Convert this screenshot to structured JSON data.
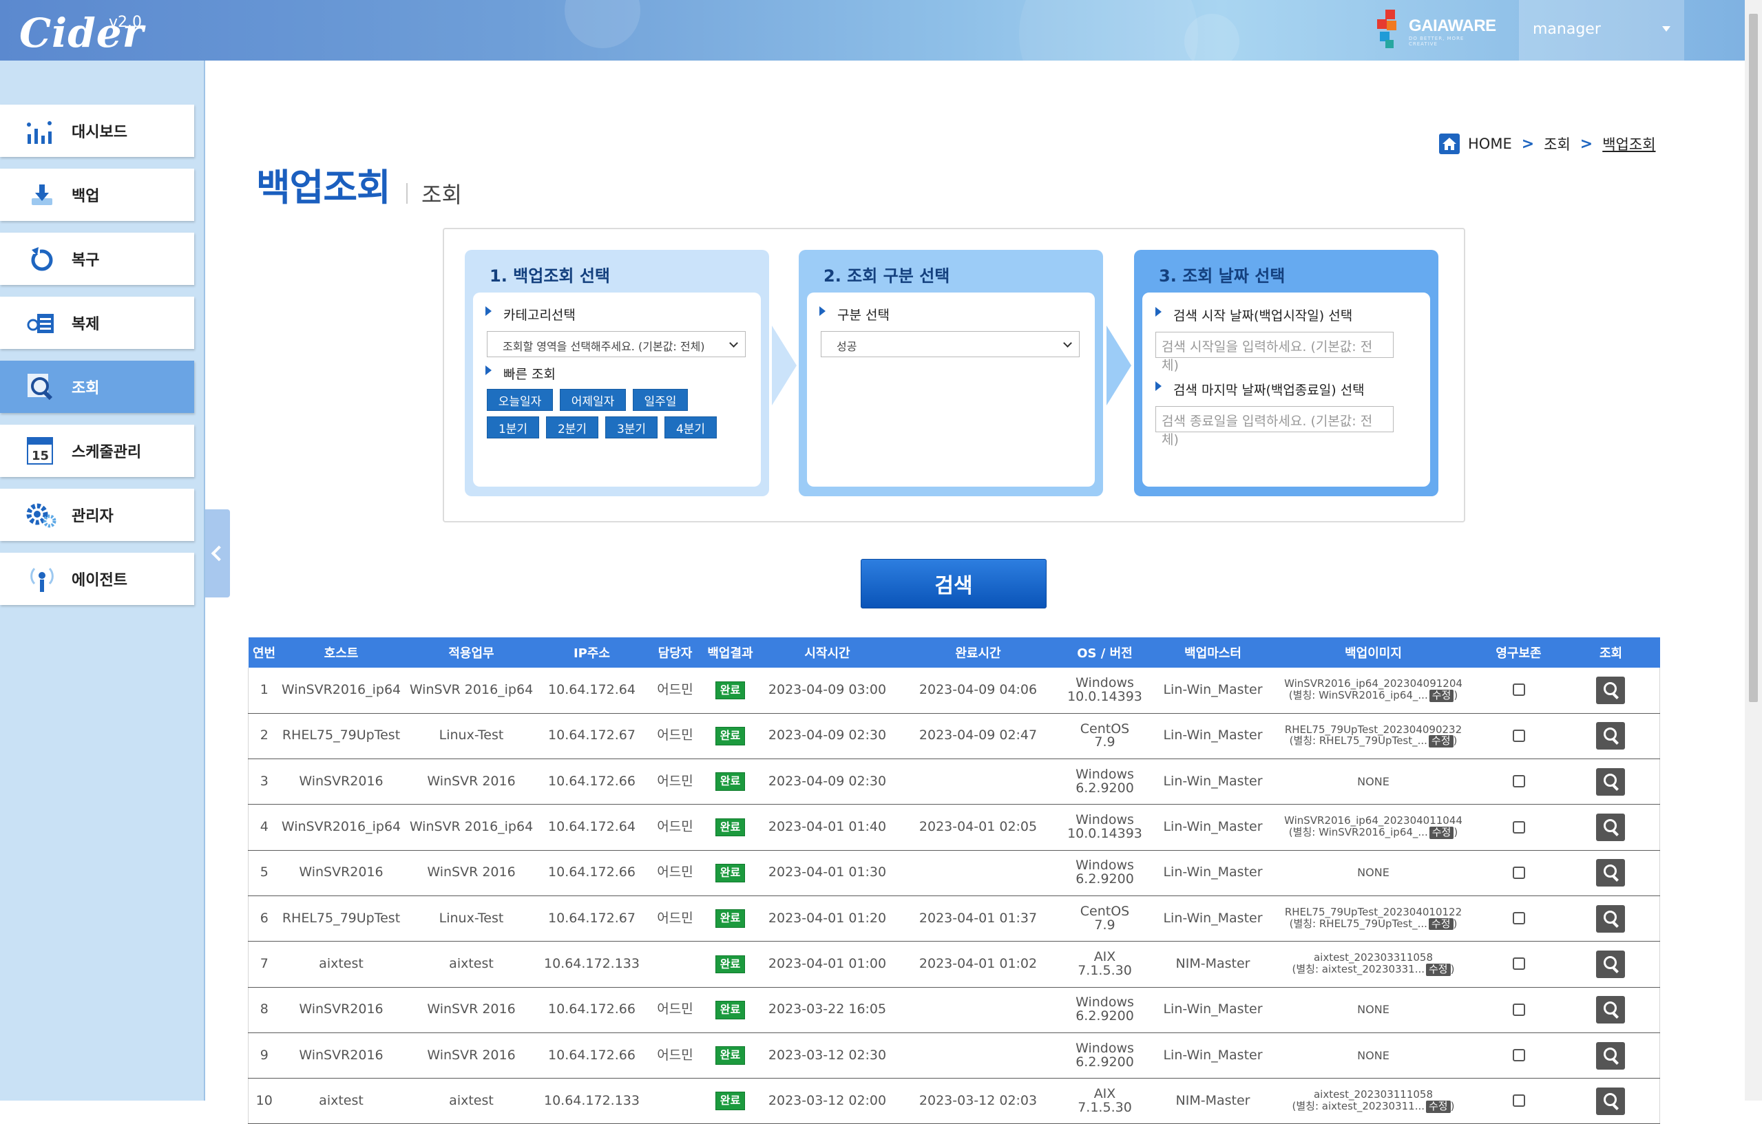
{
  "header": {
    "logo": "Cider",
    "version": "v2.0",
    "brand": "GAIAWARE",
    "brand_tagline": "DO BETTER, MORE CREATIVE",
    "user": "manager"
  },
  "sidebar": {
    "items": [
      {
        "label": "대시보드",
        "icon": "dashboard-icon"
      },
      {
        "label": "백업",
        "icon": "backup-icon"
      },
      {
        "label": "복구",
        "icon": "restore-icon"
      },
      {
        "label": "복제",
        "icon": "replicate-icon"
      },
      {
        "label": "조회",
        "icon": "search-icon",
        "active": true
      },
      {
        "label": "스케줄관리",
        "icon": "calendar-icon"
      },
      {
        "label": "관리자",
        "icon": "gear-icon"
      },
      {
        "label": "에이전트",
        "icon": "agent-icon"
      }
    ],
    "calendar_day": "15"
  },
  "breadcrumb": {
    "home": "HOME",
    "level1": "조회",
    "current": "백업조회"
  },
  "page": {
    "title": "백업조회",
    "subtitle": "조회"
  },
  "steps": {
    "step1": {
      "title": "1. 백업조회 선택",
      "category_label": "카테고리선택",
      "category_value": "조회할 영역을 선택해주세요. (기본값: 전체)",
      "quick_label": "빠른 조회",
      "quick_buttons": [
        "오늘일자",
        "어제일자",
        "일주일",
        "1분기",
        "2분기",
        "3분기",
        "4분기"
      ]
    },
    "step2": {
      "title": "2. 조회 구분 선택",
      "type_label": "구분 선택",
      "type_value": "성공"
    },
    "step3": {
      "title": "3. 조회 날짜 선택",
      "start_label": "검색 시작 날짜(백업시작일) 선택",
      "start_placeholder": "검색 시작일을 입력하세요. (기본값: 전체)",
      "end_label": "검색 마지막 날짜(백업종료일) 선택",
      "end_placeholder": "검색 종료일을 입력하세요. (기본값: 전체)"
    }
  },
  "search_button": "검색",
  "table": {
    "columns": [
      "연번",
      "호스트",
      "적용업무",
      "IP주소",
      "담당자",
      "백업결과",
      "시작시간",
      "완료시간",
      "OS / 버전",
      "백업마스터",
      "백업이미지",
      "영구보존",
      "조회"
    ],
    "fix_label": "수정",
    "rows": [
      {
        "no": "1",
        "host": "WinSVR2016_ip64",
        "work": "WinSVR 2016_ip64",
        "ip": "10.64.172.64",
        "owner": "어드민",
        "result": "완료",
        "start": "2023-04-09 03:00",
        "end": "2023-04-09 04:06",
        "os": "Windows",
        "ver": "10.0.14393",
        "master": "Lin-Win_Master",
        "image1": "WinSVR2016_ip64_202304091204",
        "image2": "(별칭: WinSVR2016_ip64_..."
      },
      {
        "no": "2",
        "host": "RHEL75_79UpTest",
        "work": "Linux-Test",
        "ip": "10.64.172.67",
        "owner": "어드민",
        "result": "완료",
        "start": "2023-04-09 02:30",
        "end": "2023-04-09 02:47",
        "os": "CentOS",
        "ver": "7.9",
        "master": "Lin-Win_Master",
        "image1": "RHEL75_79UpTest_202304090232",
        "image2": "(별칭: RHEL75_79UpTest_..."
      },
      {
        "no": "3",
        "host": "WinSVR2016",
        "work": "WinSVR 2016",
        "ip": "10.64.172.66",
        "owner": "어드민",
        "result": "완료",
        "start": "2023-04-09 02:30",
        "end": "",
        "os": "Windows",
        "ver": "6.2.9200",
        "master": "Lin-Win_Master",
        "image1": "NONE",
        "image2": ""
      },
      {
        "no": "4",
        "host": "WinSVR2016_ip64",
        "work": "WinSVR 2016_ip64",
        "ip": "10.64.172.64",
        "owner": "어드민",
        "result": "완료",
        "start": "2023-04-01 01:40",
        "end": "2023-04-01 02:05",
        "os": "Windows",
        "ver": "10.0.14393",
        "master": "Lin-Win_Master",
        "image1": "WinSVR2016_ip64_202304011044",
        "image2": "(별칭: WinSVR2016_ip64_..."
      },
      {
        "no": "5",
        "host": "WinSVR2016",
        "work": "WinSVR 2016",
        "ip": "10.64.172.66",
        "owner": "어드민",
        "result": "완료",
        "start": "2023-04-01 01:30",
        "end": "",
        "os": "Windows",
        "ver": "6.2.9200",
        "master": "Lin-Win_Master",
        "image1": "NONE",
        "image2": ""
      },
      {
        "no": "6",
        "host": "RHEL75_79UpTest",
        "work": "Linux-Test",
        "ip": "10.64.172.67",
        "owner": "어드민",
        "result": "완료",
        "start": "2023-04-01 01:20",
        "end": "2023-04-01 01:37",
        "os": "CentOS",
        "ver": "7.9",
        "master": "Lin-Win_Master",
        "image1": "RHEL75_79UpTest_202304010122",
        "image2": "(별칭: RHEL75_79UpTest_..."
      },
      {
        "no": "7",
        "host": "aixtest",
        "work": "aixtest",
        "ip": "10.64.172.133",
        "owner": "",
        "result": "완료",
        "start": "2023-04-01 01:00",
        "end": "2023-04-01 01:02",
        "os": "AIX",
        "ver": "7.1.5.30",
        "master": "NIM-Master",
        "image1": "aixtest_202303311058",
        "image2": "(별칭: aixtest_20230331..."
      },
      {
        "no": "8",
        "host": "WinSVR2016",
        "work": "WinSVR 2016",
        "ip": "10.64.172.66",
        "owner": "어드민",
        "result": "완료",
        "start": "2023-03-22 16:05",
        "end": "",
        "os": "Windows",
        "ver": "6.2.9200",
        "master": "Lin-Win_Master",
        "image1": "NONE",
        "image2": ""
      },
      {
        "no": "9",
        "host": "WinSVR2016",
        "work": "WinSVR 2016",
        "ip": "10.64.172.66",
        "owner": "어드민",
        "result": "완료",
        "start": "2023-03-12 02:30",
        "end": "",
        "os": "Windows",
        "ver": "6.2.9200",
        "master": "Lin-Win_Master",
        "image1": "NONE",
        "image2": ""
      },
      {
        "no": "10",
        "host": "aixtest",
        "work": "aixtest",
        "ip": "10.64.172.133",
        "owner": "",
        "result": "완료",
        "start": "2023-03-12 02:00",
        "end": "2023-03-12 02:03",
        "os": "AIX",
        "ver": "7.1.5.30",
        "master": "NIM-Master",
        "image1": "aixtest_202303111058",
        "image2": "(별칭: aixtest_20230311..."
      }
    ]
  },
  "colors": {
    "accent": "#1b5fbf",
    "header_blue": "#3a7fe0",
    "success": "#1c9a3e",
    "sidebar_bg": "#c9e1f5",
    "active_item": "#6aa4e4"
  }
}
